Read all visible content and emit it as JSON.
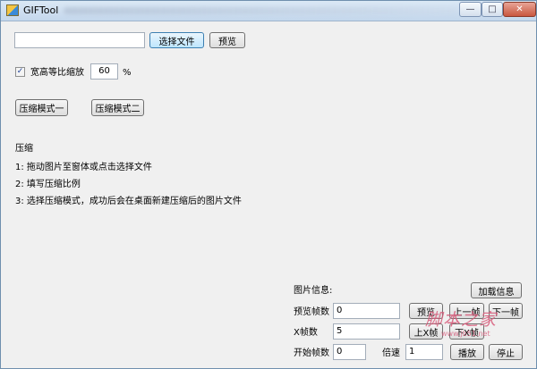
{
  "window": {
    "title": "GIFTool"
  },
  "top": {
    "file_path_value": "",
    "select_file_label": "选择文件",
    "preview_label": "预览"
  },
  "scale": {
    "checkbox_label": "宽高等比缩放",
    "checked": true,
    "value": "60",
    "unit": "%"
  },
  "modes": {
    "mode1_label": "压缩模式一",
    "mode2_label": "压缩模式二"
  },
  "instructions": {
    "heading": "压缩",
    "steps": [
      "1: 拖动图片至窗体或点击选择文件",
      "2: 填写压缩比例",
      "3: 选择压缩模式，成功后会在桌面新建压缩后的图片文件"
    ]
  },
  "image_info": {
    "title": "图片信息:",
    "load_button": "加载信息",
    "preview_frames_label": "预览帧数",
    "preview_frames_value": "0",
    "preview_button": "预览",
    "prev_frame_button": "上一帧",
    "next_frame_button": "下一帧",
    "xframes_label": "X帧数",
    "xframes_value": "5",
    "up_x_button": "上X帧",
    "down_x_button": "下X帧",
    "start_frames_label": "开始帧数",
    "start_frames_value": "0",
    "speed_label": "倍速",
    "speed_value": "1",
    "play_button": "播放",
    "stop_button": "停止"
  },
  "watermark": {
    "main": "脚本之家",
    "sub": "www.jb51.net"
  },
  "icons": {
    "app": "app-icon",
    "check": "checkmark-icon"
  }
}
